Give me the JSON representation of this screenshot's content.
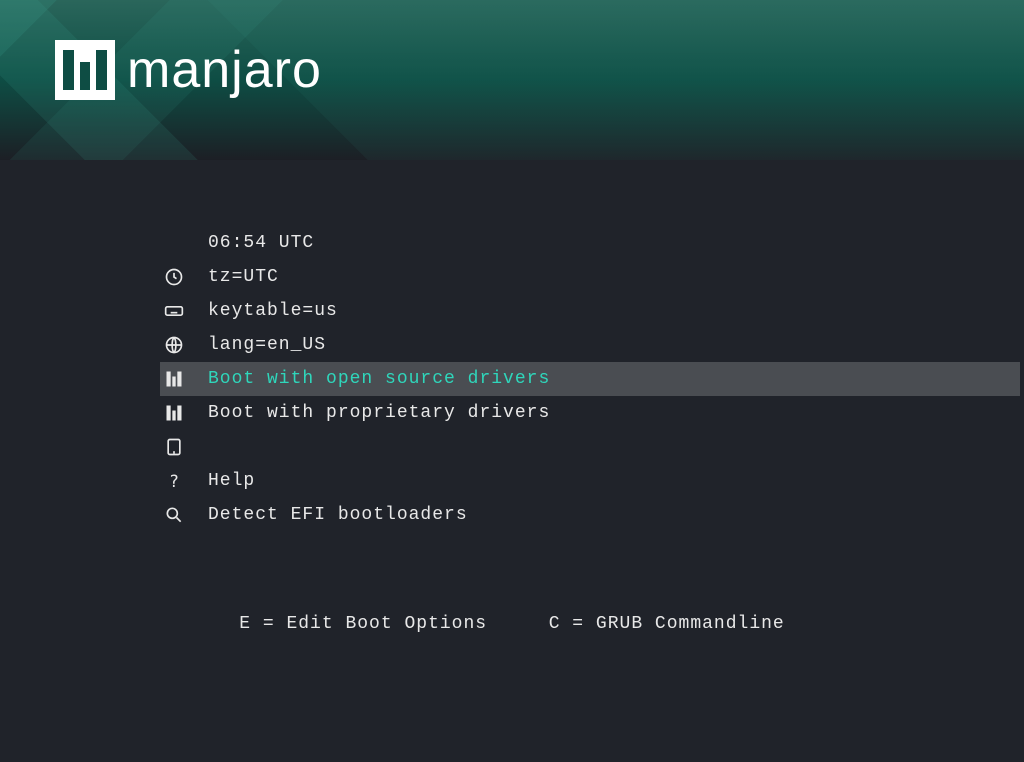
{
  "brand": {
    "name": "manjaro"
  },
  "clock": {
    "time": "06:54 UTC"
  },
  "menu": {
    "items": [
      {
        "icon": "clock-icon",
        "label": "tz=UTC",
        "selected": false
      },
      {
        "icon": "keyboard-icon",
        "label": "keytable=us",
        "selected": false
      },
      {
        "icon": "globe-icon",
        "label": "lang=en_US",
        "selected": false
      },
      {
        "icon": "manjaro-icon",
        "label": "Boot with open source drivers",
        "selected": true
      },
      {
        "icon": "manjaro-icon",
        "label": "Boot with proprietary drivers",
        "selected": false
      },
      {
        "icon": "boot-icon",
        "label": "",
        "selected": false
      },
      {
        "icon": "help-icon",
        "label": "Help",
        "selected": false
      },
      {
        "icon": "search-icon",
        "label": "Detect EFI bootloaders",
        "selected": false
      }
    ]
  },
  "hints": {
    "edit": "E = Edit Boot Options",
    "cmd": "C = GRUB Commandline"
  },
  "colors": {
    "accent": "#2fd6bb",
    "bg": "#20232a",
    "highlight": "#4a4d52"
  }
}
